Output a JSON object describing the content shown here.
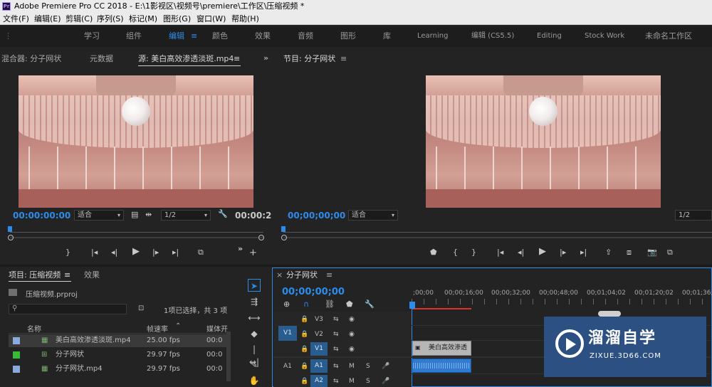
{
  "window": {
    "title": "Adobe Premiere Pro CC 2018 - E:\\1影视区\\视频号\\premiere\\工作区\\压缩视频 *",
    "app_icon_text": "Pr"
  },
  "menu": [
    "文件(F)",
    "编辑(E)",
    "剪辑(C)",
    "序列(S)",
    "标记(M)",
    "图形(G)",
    "窗口(W)",
    "帮助(H)"
  ],
  "workspaces": {
    "items": [
      "学习",
      "组件",
      "编辑",
      "颜色",
      "效果",
      "音频",
      "图形",
      "库",
      "Learning",
      "编辑 (CS5.5)",
      "Editing",
      "Stock Work",
      "未命名工作区"
    ],
    "active_index": 2
  },
  "source_monitor": {
    "tabs": [
      "混合器: 分子网状",
      "元数据",
      "源: 美白高效渗透淡斑.mp4"
    ],
    "active_tab": 2,
    "timecode": "00:00:00:00",
    "fit": "适合",
    "resolution": "1/2",
    "end_timecode": "00:00:2"
  },
  "program_monitor": {
    "title": "节目: 分子网状",
    "timecode": "00;00;00;00",
    "fit": "适合",
    "resolution": "1/2"
  },
  "project_panel": {
    "tabs": [
      "项目: 压缩视频",
      "效果"
    ],
    "file": "压缩视频.prproj",
    "selection_info": "1项已选择，共 3 项",
    "columns": [
      "名称",
      "帧速率",
      "媒体开"
    ],
    "items": [
      {
        "name": "美白高效渗透淡斑.mp4",
        "fps": "25.00 fps",
        "media": "00:0",
        "color": "#8aa9dc",
        "selected": true
      },
      {
        "name": "分子网状",
        "fps": "29.97 fps",
        "media": "00:0",
        "color": "#3ab83a",
        "selected": false
      },
      {
        "name": "分子网状.mp4",
        "fps": "29.97 fps",
        "media": "00:0",
        "color": "#8aa9dc",
        "selected": false
      }
    ]
  },
  "timeline": {
    "sequence_name": "分子网状",
    "timecode": "00;00;00;00",
    "ruler": [
      ";00;00",
      "00;00;16;00",
      "00;00;32;00",
      "00;00;48;00",
      "00;01;04;02",
      "00;01;20;02",
      "00;01;36;0"
    ],
    "tracks": {
      "video": [
        "V3",
        "V2",
        "V1"
      ],
      "audio": [
        "A1",
        "A2"
      ],
      "source_patch_video": "V1",
      "source_patch_audio": "A1"
    },
    "track_buttons": {
      "mute": "M",
      "solo": "S"
    },
    "video_clip_label": "美白高效渗透"
  },
  "watermark": {
    "brand": "溜溜自学",
    "url": "ZIXUE.3D66.COM"
  }
}
